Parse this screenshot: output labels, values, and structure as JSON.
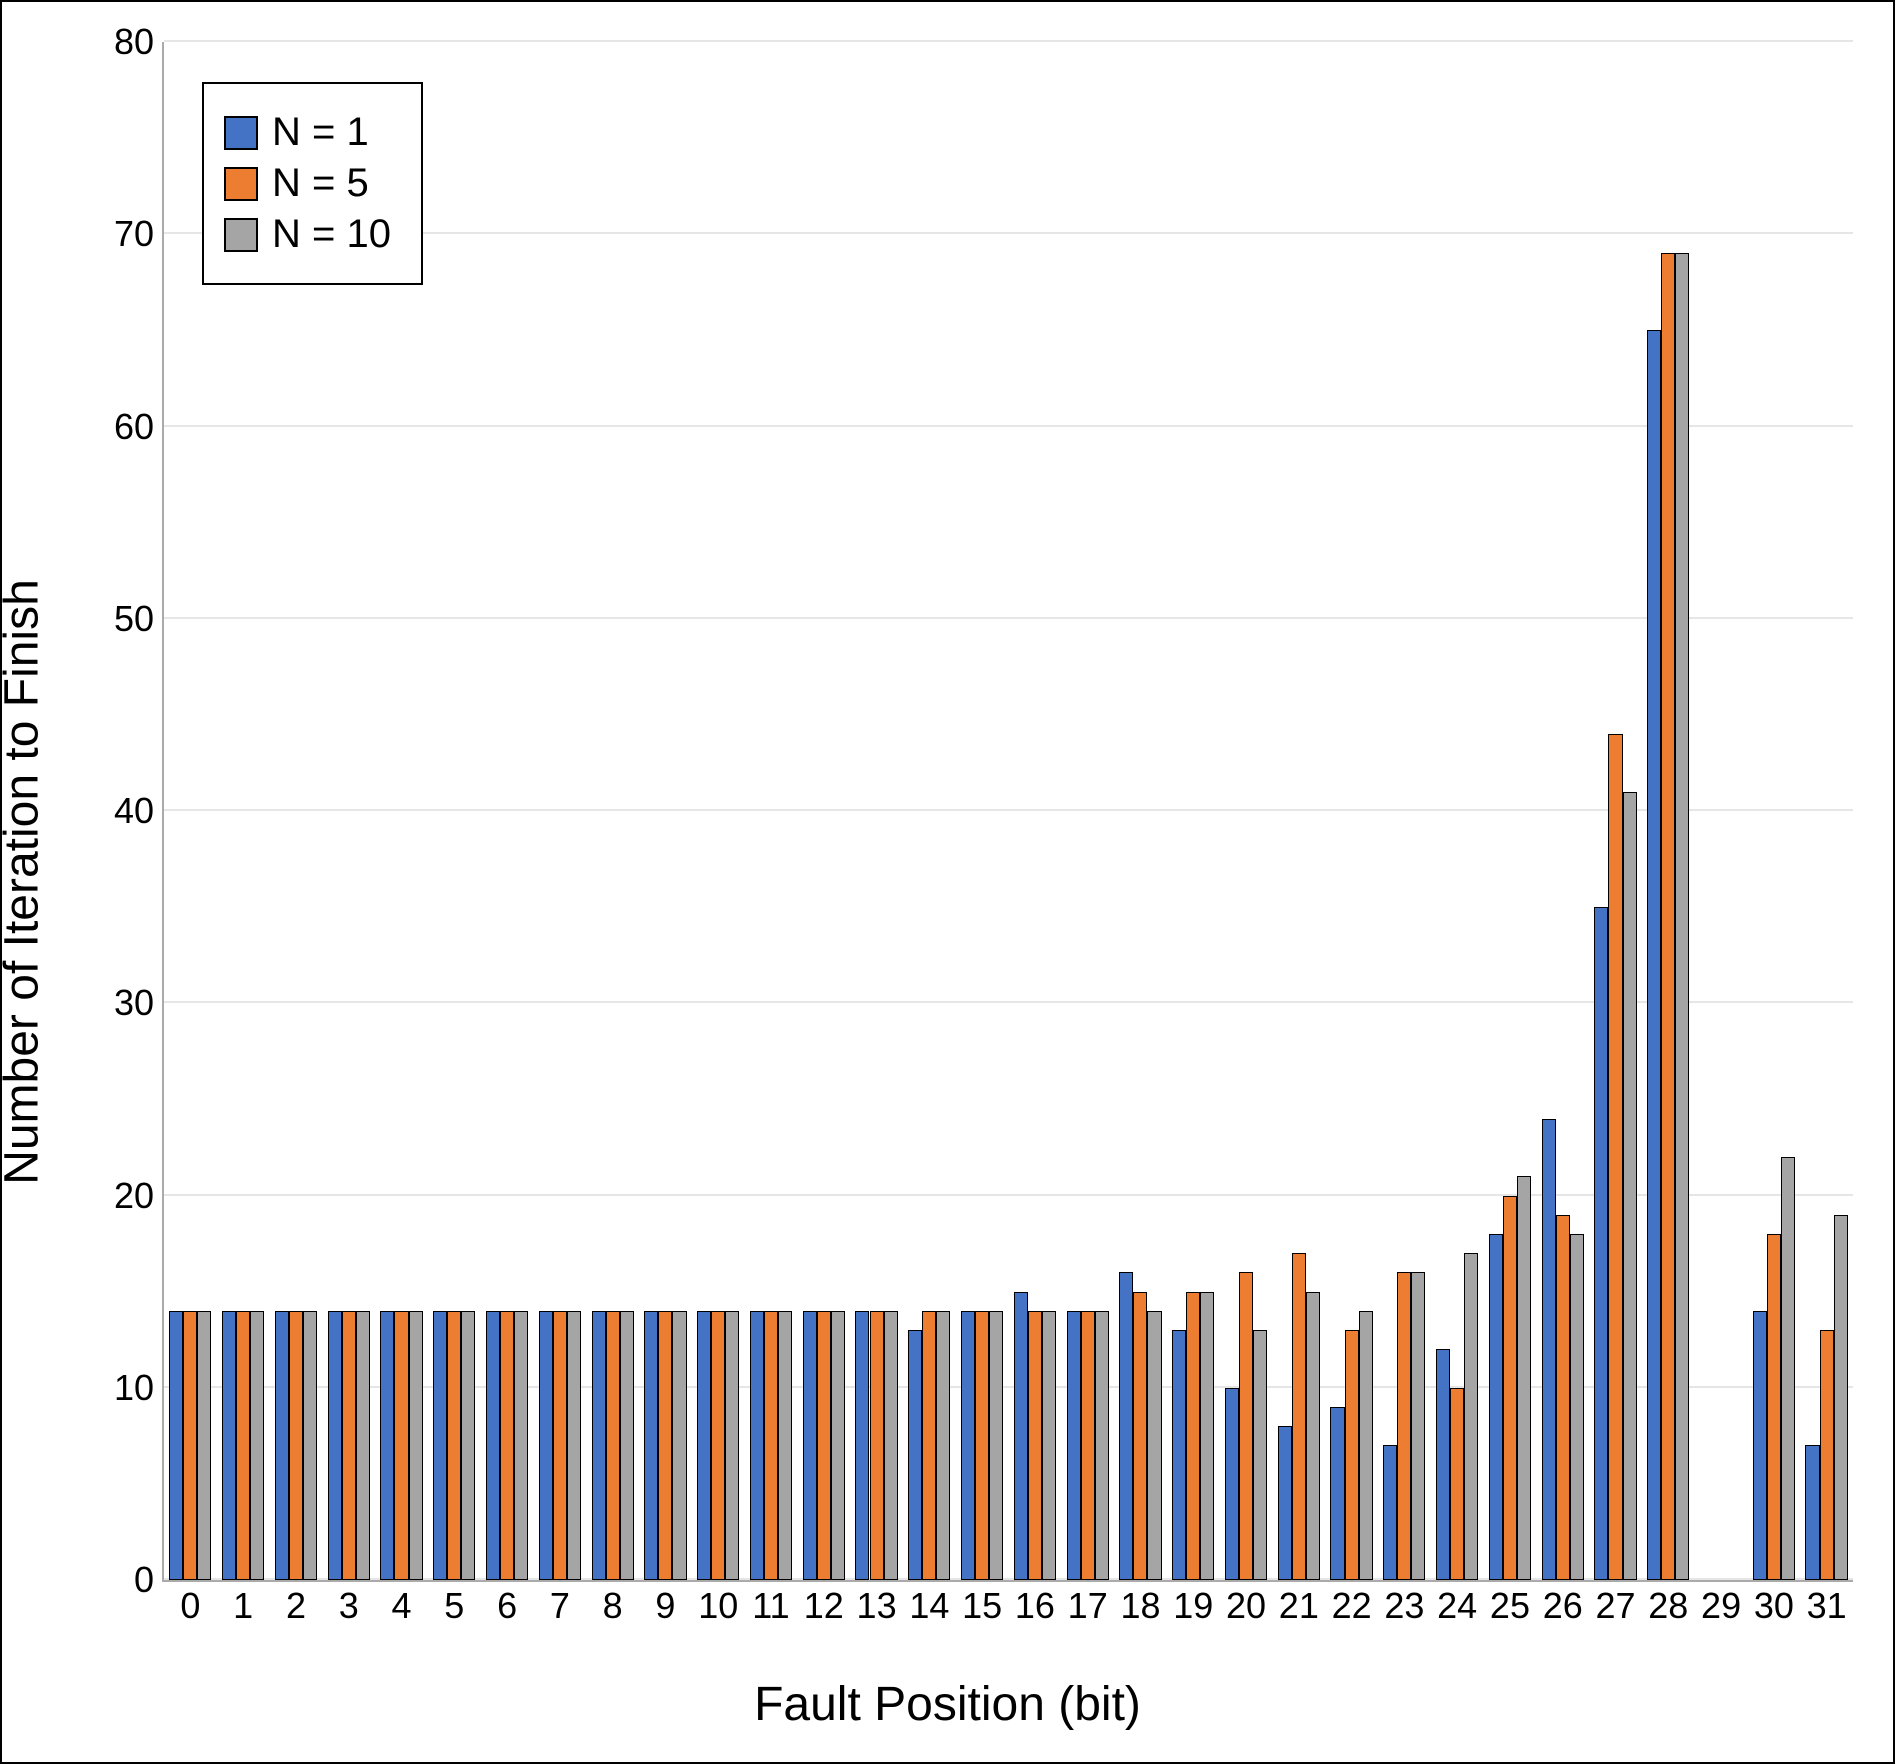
{
  "chart_data": {
    "type": "bar",
    "xlabel": "Fault Position (bit)",
    "ylabel": "Number of Iteration to Finish",
    "ylim": [
      0,
      80
    ],
    "yticks": [
      0,
      10,
      20,
      30,
      40,
      50,
      60,
      70,
      80
    ],
    "categories": [
      "0",
      "1",
      "2",
      "3",
      "4",
      "5",
      "6",
      "7",
      "8",
      "9",
      "10",
      "11",
      "12",
      "13",
      "14",
      "15",
      "16",
      "17",
      "18",
      "19",
      "20",
      "21",
      "22",
      "23",
      "24",
      "25",
      "26",
      "27",
      "28",
      "29",
      "30",
      "31"
    ],
    "series": [
      {
        "name": "N = 1",
        "color": "#4472c4",
        "values": [
          14,
          14,
          14,
          14,
          14,
          14,
          14,
          14,
          14,
          14,
          14,
          14,
          14,
          14,
          13,
          14,
          15,
          14,
          16,
          13,
          10,
          8,
          9,
          7,
          12,
          18,
          24,
          35,
          65,
          0,
          14,
          7
        ]
      },
      {
        "name": "N = 5",
        "color": "#ed7d31",
        "values": [
          14,
          14,
          14,
          14,
          14,
          14,
          14,
          14,
          14,
          14,
          14,
          14,
          14,
          14,
          14,
          14,
          14,
          14,
          15,
          15,
          16,
          17,
          13,
          16,
          10,
          20,
          19,
          44,
          69,
          0,
          18,
          13
        ]
      },
      {
        "name": "N = 10",
        "color": "#a5a5a5",
        "values": [
          14,
          14,
          14,
          14,
          14,
          14,
          14,
          14,
          14,
          14,
          14,
          14,
          14,
          14,
          14,
          14,
          14,
          14,
          14,
          15,
          13,
          15,
          14,
          16,
          17,
          21,
          18,
          41,
          69,
          0,
          22,
          19
        ]
      }
    ],
    "legend_position": "top-left",
    "grid": true
  }
}
